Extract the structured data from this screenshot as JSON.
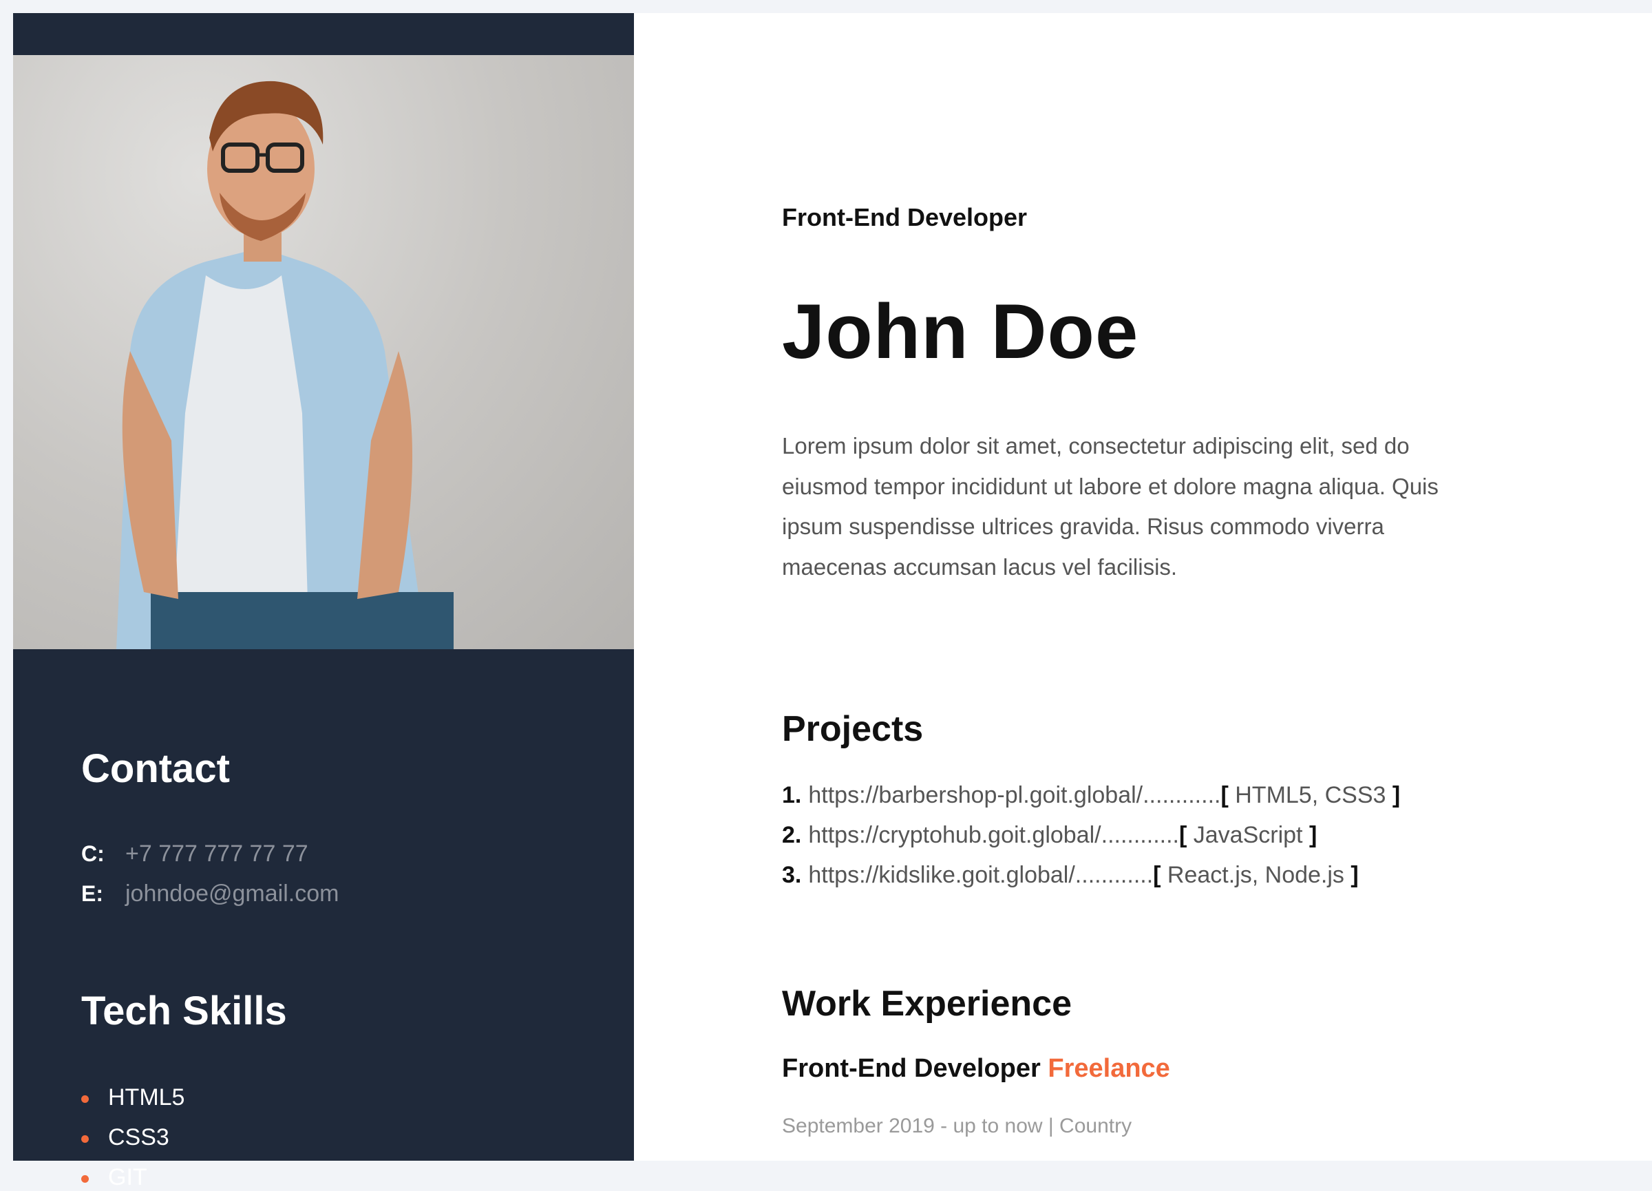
{
  "sidebar": {
    "contact_heading": "Contact",
    "contact": [
      {
        "label": "C:",
        "value": "+7 777 777 77 77"
      },
      {
        "label": "E:",
        "value": "johndoe@gmail.com"
      }
    ],
    "skills_heading": "Tech Skills",
    "skills": [
      "HTML5",
      "CSS3",
      "GIT"
    ]
  },
  "main": {
    "role": "Front-End Developer",
    "name": "John Doe",
    "bio": "Lorem ipsum dolor sit amet, consectetur adipiscing elit, sed do eiusmod tempor incididunt ut labore et dolore magna aliqua. Quis ipsum suspendisse ultrices gravida. Risus commodo viverra maecenas accumsan lacus vel facilisis.",
    "projects_heading": "Projects",
    "projects": [
      {
        "num": "1.",
        "url": "https://barbershop-pl.goit.global/",
        "dots": "............",
        "tech": " HTML5, CSS3 "
      },
      {
        "num": "2.",
        "url": "https://cryptohub.goit.global/",
        "dots": "............",
        "tech": " JavaScript "
      },
      {
        "num": "3.",
        "url": "https://kidslike.goit.global/",
        "dots": "............",
        "tech": " React.js, Node.js "
      }
    ],
    "work_heading": "Work Experience",
    "job_title": "Front-End Developer",
    "job_company": "Freelance",
    "job_dates": "September 2019 - up to now | Country",
    "bracket_open": "[",
    "bracket_close": "]"
  },
  "colors": {
    "sidebar": "#1f293a",
    "accent": "#f26a3b"
  }
}
